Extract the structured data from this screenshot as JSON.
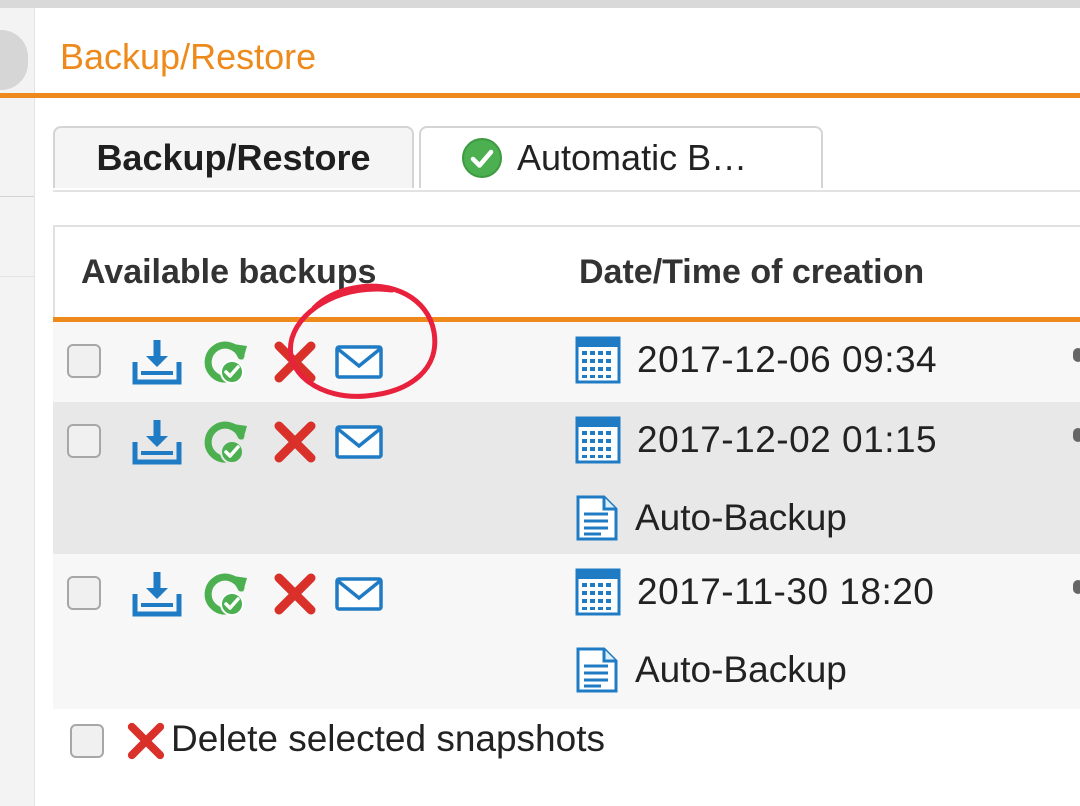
{
  "window": {
    "title": "Backup/Restore"
  },
  "tabs": [
    {
      "label": "Backup/Restore",
      "active": true
    },
    {
      "label": "Automatic B…",
      "active": false,
      "icon": "check-circle-icon",
      "icon_color": "#4caf50"
    }
  ],
  "grid": {
    "columns": [
      "Available backups",
      "Date/Time of creation"
    ],
    "rows": [
      {
        "date": "2017-12-06 09:34",
        "description": "",
        "actions": [
          "download-icon",
          "restore-icon",
          "delete-icon",
          "mail-icon"
        ]
      },
      {
        "date": "2017-12-02 01:15",
        "description": "Auto-Backup",
        "actions": [
          "download-icon",
          "restore-icon",
          "delete-icon",
          "mail-icon"
        ]
      },
      {
        "date": "2017-11-30 18:20",
        "description": "Auto-Backup",
        "actions": [
          "download-icon",
          "restore-icon",
          "delete-icon",
          "mail-icon"
        ]
      }
    ]
  },
  "footer": {
    "delete_selected_label": "Delete selected snapshots"
  },
  "annotation": {
    "shape": "hand-drawn-circle",
    "target": "mail-icon in first row",
    "color": "#e8213c"
  },
  "colors": {
    "accent": "#ee8a1c",
    "icon_blue": "#1f7cc4",
    "icon_green": "#4caf50",
    "delete_red": "#d9302a"
  }
}
